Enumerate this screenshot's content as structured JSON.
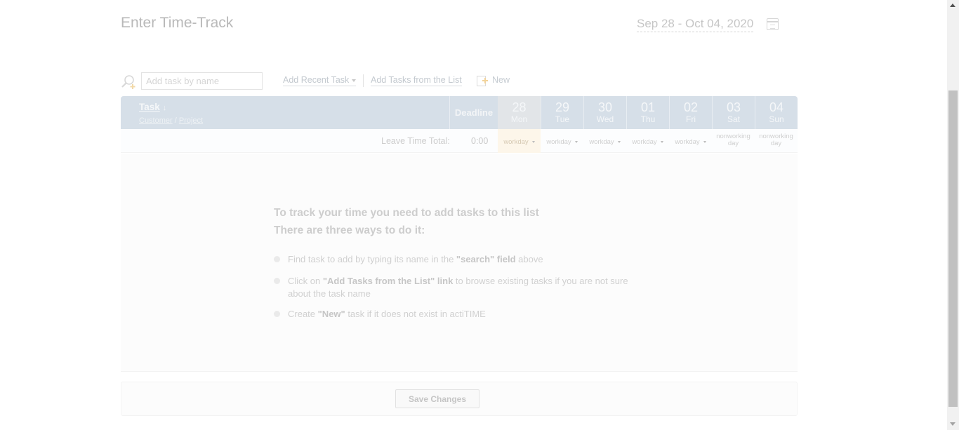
{
  "header": {
    "title": "Enter Time-Track",
    "date_range": "Sep 28 - Oct 04, 2020"
  },
  "toolbar": {
    "search_placeholder": "Add task by name",
    "add_recent_label": "Add Recent Task",
    "add_from_list_label": "Add Tasks from the List",
    "new_label": "New"
  },
  "grid": {
    "task_header": "Task",
    "sort_arrow": "↓",
    "customer_link": "Customer",
    "separator": "/",
    "project_link": "Project",
    "deadline_header": "Deadline",
    "days": [
      {
        "num": "28",
        "name": "Mon",
        "leave": "workday"
      },
      {
        "num": "29",
        "name": "Tue",
        "leave": "workday"
      },
      {
        "num": "30",
        "name": "Wed",
        "leave": "workday"
      },
      {
        "num": "01",
        "name": "Thu",
        "leave": "workday"
      },
      {
        "num": "02",
        "name": "Fri",
        "leave": "workday"
      },
      {
        "num": "03",
        "name": "Sat",
        "leave_line1": "nonworking",
        "leave_line2": "day"
      },
      {
        "num": "04",
        "name": "Sun",
        "leave_line1": "nonworking",
        "leave_line2": "day"
      }
    ],
    "leave_label": "Leave Time Total:",
    "leave_total": "0:00"
  },
  "empty_state": {
    "title_line1": "To track your time you need to add tasks to this list",
    "title_line2": "There are three ways to do it:",
    "bullet1_pre": "Find task to add by typing its name in the ",
    "bullet1_bold": "\"search\" field",
    "bullet1_post": " above",
    "bullet2_pre": "Click on ",
    "bullet2_bold": "\"Add Tasks from the List\" link",
    "bullet2_post": " to browse existing tasks if you are not sure about the task name",
    "bullet3_pre": "Create ",
    "bullet3_bold": "\"New\"",
    "bullet3_post": " task if it does not exist in actiTIME"
  },
  "footer": {
    "save_label": "Save Changes"
  }
}
